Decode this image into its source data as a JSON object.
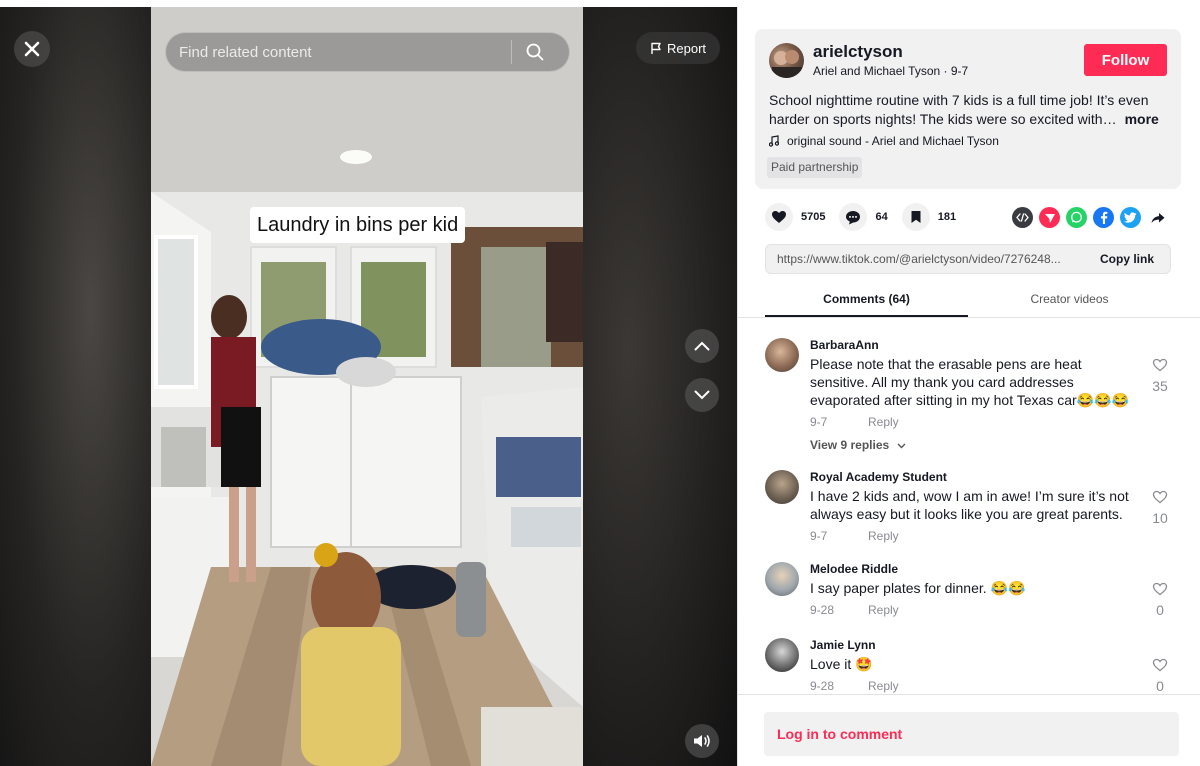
{
  "video": {
    "caption": "Laundry in bins per kid",
    "search_placeholder": "Find related content",
    "report_label": "Report"
  },
  "author": {
    "username": "arielctyson",
    "display_name": "Ariel and Michael Tyson",
    "date": "9-7",
    "follow_label": "Follow",
    "description": "School nighttime routine with 7 kids is a full time job! It’s even harder on sports nights! The kids were so excited with…",
    "more_label": "more",
    "sound": "original sound - Ariel and Michael Tyson",
    "paid_tag": "Paid partnership"
  },
  "actions": {
    "likes": "5705",
    "comments": "64",
    "saves": "181"
  },
  "share": {
    "link": "https://www.tiktok.com/@arielctyson/video/7276248...",
    "copy_label": "Copy link"
  },
  "tabs": {
    "comments": "Comments (64)",
    "creator": "Creator videos"
  },
  "comments": [
    {
      "user": "BarbaraAnn",
      "text": "Please note that the erasable pens are heat sensitive. All my thank you card addresses evaporated after sitting in my hot Texas car😂😂😂",
      "date": "9-7",
      "reply": "Reply",
      "likes": "35",
      "view_replies": "View 9 replies"
    },
    {
      "user": "Royal Academy Student",
      "text": "I have 2 kids and, wow I am in awe! I’m sure it’s not always easy but it looks like you are great parents.",
      "date": "9-7",
      "reply": "Reply",
      "likes": "10"
    },
    {
      "user": "Melodee Riddle",
      "text": "I say paper plates for dinner. 😂😂",
      "date": "9-28",
      "reply": "Reply",
      "likes": "0"
    },
    {
      "user": "Jamie Lynn",
      "text": "Love it 🤩",
      "date": "9-28",
      "reply": "Reply",
      "likes": "0"
    }
  ],
  "login_label": "Log in to comment",
  "colors": {
    "accent": "#fe2c55",
    "panel_bg": "#f1f1f2"
  },
  "icons": [
    "close-icon",
    "search-icon",
    "flag-icon",
    "chevron-up-icon",
    "chevron-down-icon",
    "volume-icon",
    "heart-icon",
    "comment-icon",
    "bookmark-icon",
    "embed-icon",
    "paper-plane-icon",
    "whatsapp-icon",
    "facebook-icon",
    "twitter-icon",
    "share-arrow-icon",
    "music-note-icon"
  ]
}
